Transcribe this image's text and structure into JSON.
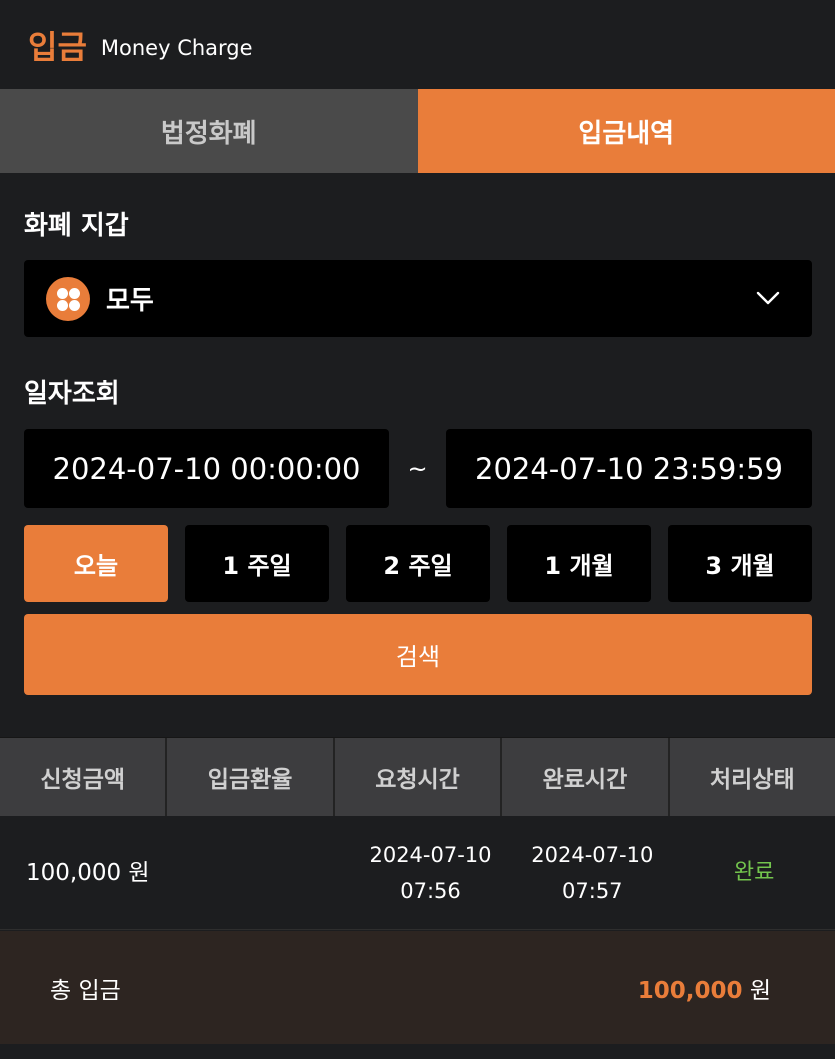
{
  "header": {
    "title": "입금",
    "subtitle": "Money Charge"
  },
  "tabs": [
    {
      "label": "법정화폐",
      "active": false
    },
    {
      "label": "입금내역",
      "active": true
    }
  ],
  "wallet": {
    "label": "화폐 지갑",
    "selected": "모두",
    "icon": "coin-grid-icon"
  },
  "date_query": {
    "label": "일자조회",
    "start": "2024-07-10 00:00:00",
    "separator": "~",
    "end": "2024-07-10 23:59:59"
  },
  "ranges": [
    "오늘",
    "1 주일",
    "2 주일",
    "1 개월",
    "3 개월"
  ],
  "search_label": "검색",
  "table": {
    "headers": [
      "신청금액",
      "입금환율",
      "요청시간",
      "완료시간",
      "처리상태"
    ],
    "rows": [
      {
        "amount": "100,000 원",
        "rate": "",
        "request_date": "2024-07-10",
        "request_time": "07:56",
        "complete_date": "2024-07-10",
        "complete_time": "07:57",
        "status": "완료"
      }
    ]
  },
  "total": {
    "label": "총 입금",
    "value": "100,000",
    "unit": "원"
  },
  "colors": {
    "accent": "#e97d3a",
    "status_done": "#73c44d",
    "background": "#1c1d1f"
  }
}
